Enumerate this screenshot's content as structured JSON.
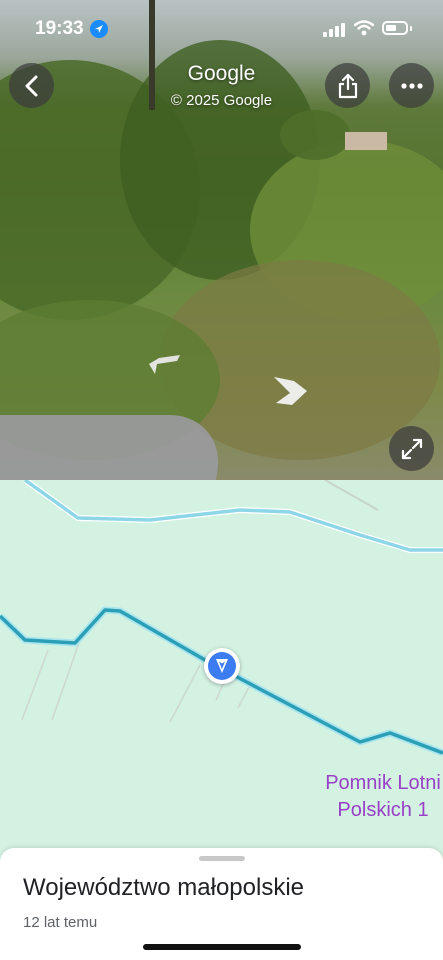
{
  "status_bar": {
    "time": "19:33"
  },
  "header": {
    "title": "Google",
    "copyright": "© 2025 Google"
  },
  "icons": {
    "back": "chevron-left-icon",
    "share": "share-icon",
    "more": "more-horizontal-icon",
    "expand": "expand-icon",
    "nav_prev": "navigation-arrow-left-icon",
    "nav_next": "navigation-arrow-right-icon",
    "location": "location-arrow-icon"
  },
  "map": {
    "poi_label_line1": "Pomnik Lotni",
    "poi_label_line2": "Polskich 1",
    "background": "#d3f2e2",
    "road_color": "#2a9fb5",
    "poi_color": "#9a40c8"
  },
  "sheet": {
    "title": "Województwo małopolskie",
    "subtitle": "12 lat temu"
  }
}
